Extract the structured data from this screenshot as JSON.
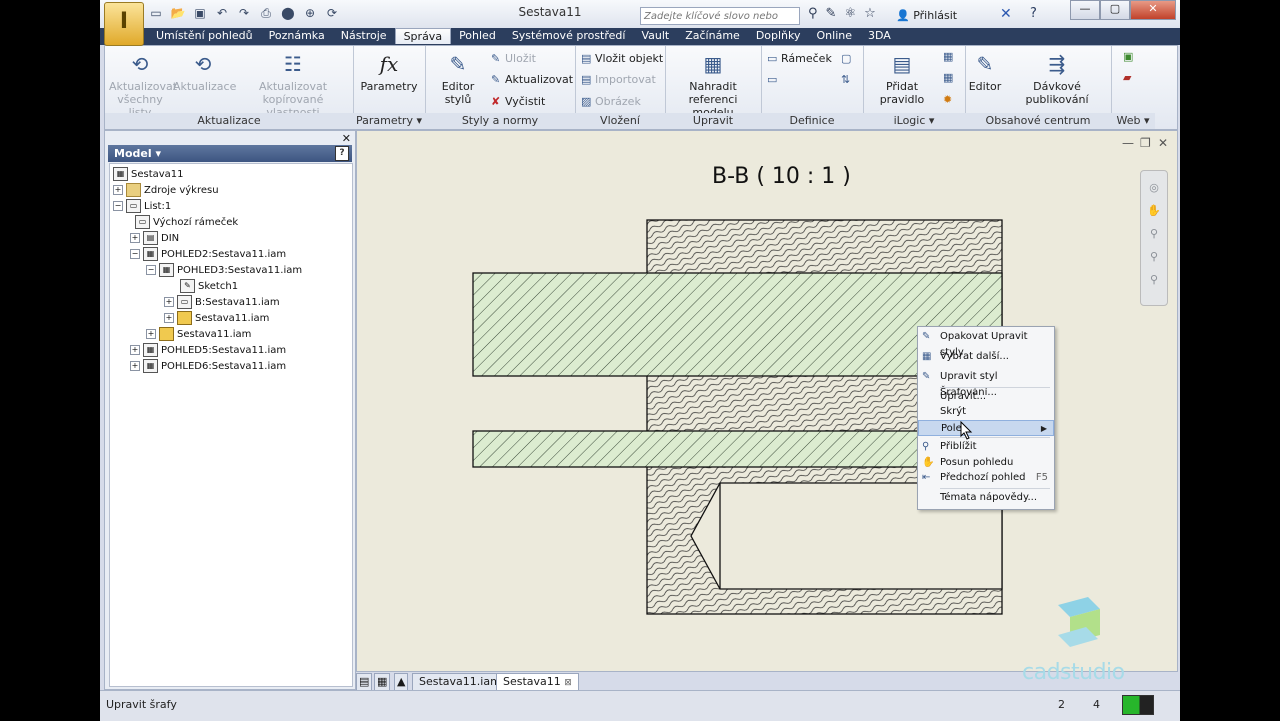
{
  "window": {
    "title": "Sestava11",
    "app_logo_letter": "I"
  },
  "search": {
    "placeholder": "Zadejte klíčové slovo nebo výraz."
  },
  "login_label": "Přihlásit",
  "tabs": [
    "Umístění pohledů",
    "Poznámka",
    "Nástroje",
    "Správa",
    "Pohled",
    "Systémové prostředí",
    "Vault",
    "Začínáme",
    "Doplňky",
    "Online",
    "3DA"
  ],
  "active_tab": "Správa",
  "ribbon": {
    "aktualizace": {
      "title": "Aktualizace",
      "buttons": [
        "Aktualizovat všechny listy",
        "Aktualizace",
        "Aktualizovat kopírované vlastnosti"
      ]
    },
    "parametry": {
      "title": "Parametry",
      "button": "Parametry",
      "icon_text": "fx"
    },
    "styly": {
      "title": "Styly a normy",
      "editor": "Editor stylů",
      "ulozit": "Uložit",
      "aktualizovat": "Aktualizovat",
      "vycistit": "Vyčistit"
    },
    "vlozeni": {
      "title": "Vložení",
      "vlozit_objekt": "Vložit objekt",
      "importovat": "Importovat",
      "obrazek": "Obrázek"
    },
    "upravit": {
      "title": "Upravit",
      "nahradit": "Nahradit referenci modelu"
    },
    "definice": {
      "title": "Definice",
      "ramecek": "Rámeček"
    },
    "ilogic": {
      "title": "iLogic",
      "pridat": "Přidat pravidlo"
    },
    "obsahove": {
      "title": "Obsahové centrum",
      "editor": "Editor",
      "davkove": "Dávkové publikování"
    },
    "web": {
      "title": "Web"
    }
  },
  "browser": {
    "title": "Model",
    "nodes": [
      "Sestava11",
      "Zdroje výkresu",
      "List:1",
      "Výchozí rámeček",
      "DIN",
      "POHLED2:Sestava11.iam",
      "POHLED3:Sestava11.iam",
      "Sketch1",
      "B:Sestava11.iam",
      "Sestava11.iam",
      "Sestava11.iam",
      "POHLED5:Sestava11.iam",
      "POHLED6:Sestava11.iam"
    ]
  },
  "drawing": {
    "section_label": "B-B ( 10 : 1 )"
  },
  "context_menu": {
    "items": [
      {
        "label": "Opakovat Upravit styly",
        "icon": "brush-icon",
        "shortcut": ""
      },
      {
        "label": "Vybrat další...",
        "icon": "select-icon",
        "shortcut": ""
      },
      {
        "label": "Upravit styl Šrafování...",
        "icon": "brush-icon",
        "shortcut": ""
      },
      {
        "label": "Upravit...",
        "icon": "",
        "shortcut": ""
      },
      {
        "label": "Skrýt",
        "icon": "",
        "shortcut": ""
      },
      {
        "label": "Pole",
        "icon": "",
        "shortcut": ""
      },
      {
        "label": "Přiblížit",
        "icon": "zoom-icon",
        "shortcut": ""
      },
      {
        "label": "Posun pohledu",
        "icon": "pan-icon",
        "shortcut": ""
      },
      {
        "label": "Předchozí pohled",
        "icon": "previous-view-icon",
        "shortcut": "F5"
      },
      {
        "label": "Témata nápovědy...",
        "icon": "",
        "shortcut": ""
      }
    ]
  },
  "doc_tabs": [
    "Sestava11.iam",
    "Sestava11"
  ],
  "status": {
    "text": "Upravit šrafy",
    "num1": "2",
    "num2": "4"
  },
  "watermark": "cadstudio",
  "colors": {
    "hatch_green": "#dcecd0",
    "canvas": "#eceadc",
    "tabbar": "#2c3e5e"
  }
}
